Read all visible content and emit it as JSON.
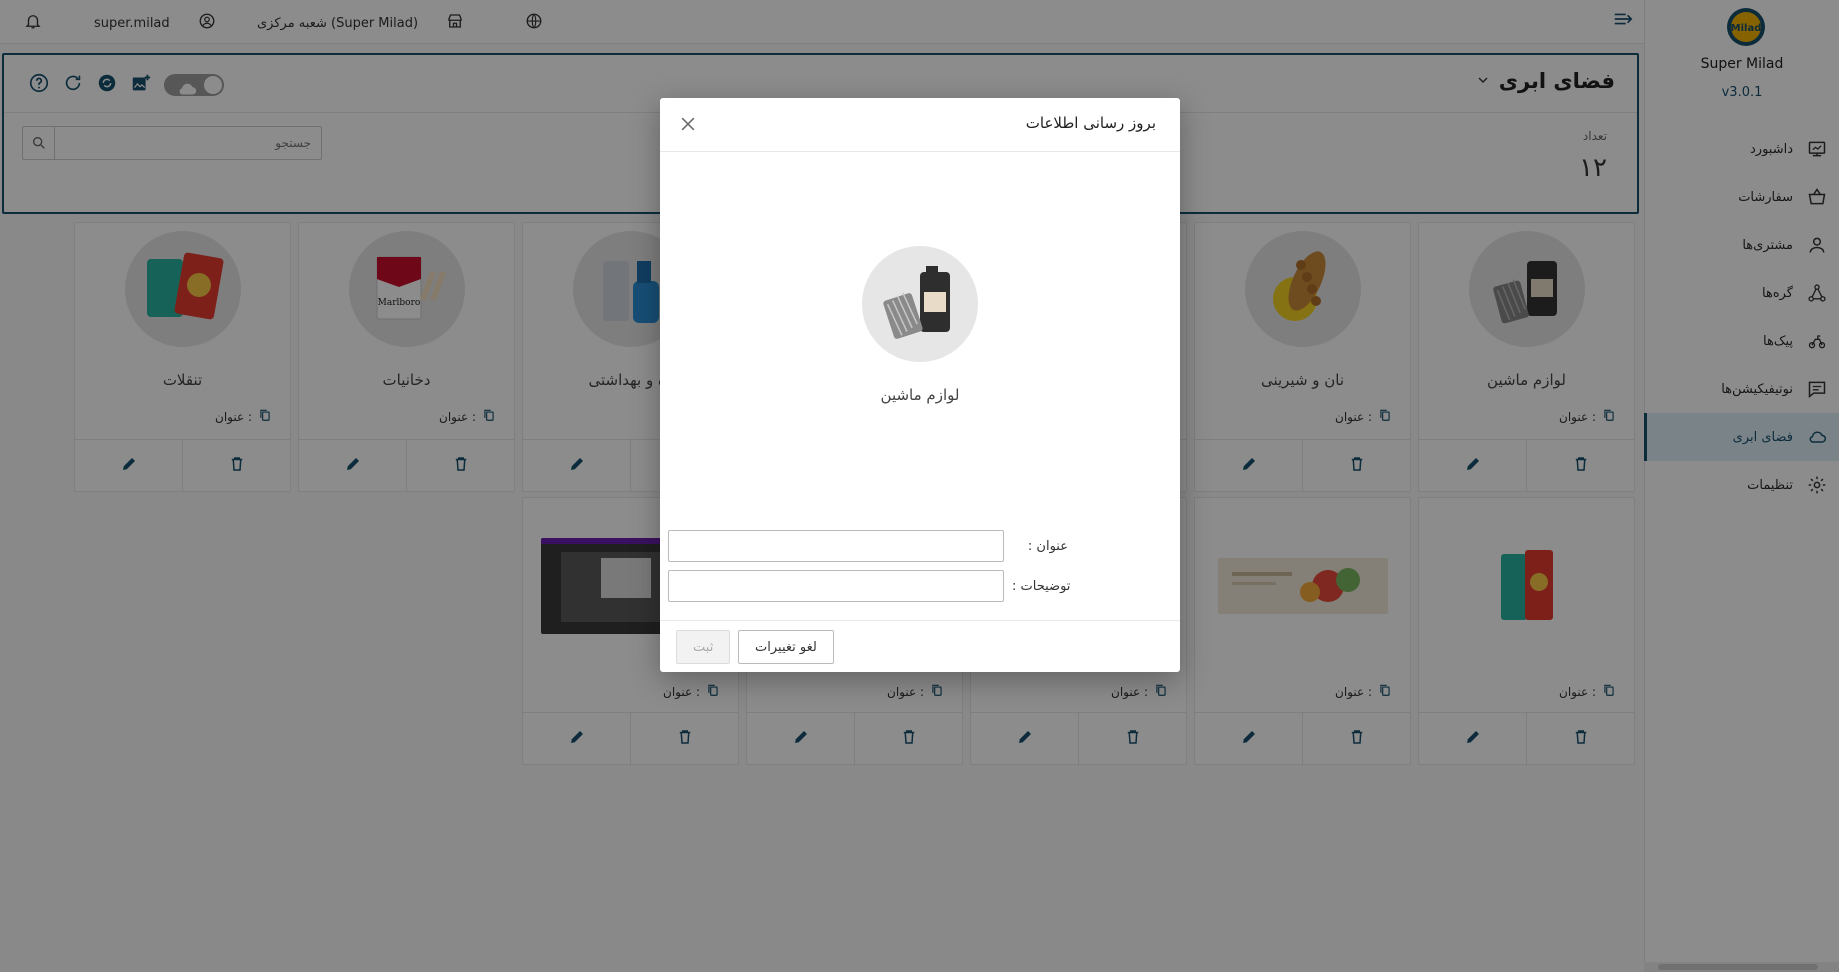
{
  "app": {
    "brand": "Super Milad",
    "version": "v3.0.1",
    "logo_text": "Milad"
  },
  "topbar": {
    "username": "super.milad",
    "branch": "شعبه مرکزی (Super Milad)"
  },
  "sidebar": {
    "items": [
      {
        "label": "داشبورد",
        "icon": "dashboard-icon"
      },
      {
        "label": "سفارشات",
        "icon": "basket-icon"
      },
      {
        "label": "مشتری‌ها",
        "icon": "person-icon"
      },
      {
        "label": "گره‌ها",
        "icon": "nodes-icon"
      },
      {
        "label": "پیک‌ها",
        "icon": "courier-icon"
      },
      {
        "label": "نوتیفیکیشن‌ها",
        "icon": "chat-icon"
      },
      {
        "label": "فضای ابری",
        "icon": "cloud-icon",
        "active": true
      },
      {
        "label": "تنظیمات",
        "icon": "gear-icon"
      }
    ]
  },
  "panel": {
    "title": "فضای ابری",
    "count_label": "تعداد",
    "count_value": "۱۲",
    "search_placeholder": "جستجو"
  },
  "cards": {
    "title_label": "عنوان :",
    "row1": [
      {
        "name": "لوازم ماشین",
        "image": "car-parts"
      },
      {
        "name": "نان و شیرینی",
        "image": "bread"
      },
      {
        "name": "",
        "image": ""
      },
      {
        "name": "",
        "image": ""
      },
      {
        "name": "ده و بهداشتی",
        "image": "cleaning"
      },
      {
        "name": "دخانیات",
        "image": "cigarettes"
      },
      {
        "name": "تنقلات",
        "image": "snacks"
      }
    ],
    "row2": [
      {
        "image": "snacks"
      },
      {
        "image": "veg-banner"
      },
      {
        "image": ""
      },
      {
        "image": ""
      },
      {
        "image": "screenshot"
      }
    ]
  },
  "modal": {
    "title": "بروز رسانی اطلاعات",
    "caption": "لوازم ماشین",
    "title_field_label": "عنوان :",
    "title_field_value": "",
    "desc_field_label": "توضیحات :",
    "desc_field_value": "",
    "cancel_label": "لغو تغییرات",
    "submit_label": "ثبت"
  },
  "colors": {
    "accent": "#16506e",
    "active_bg": "#dff0f7"
  }
}
